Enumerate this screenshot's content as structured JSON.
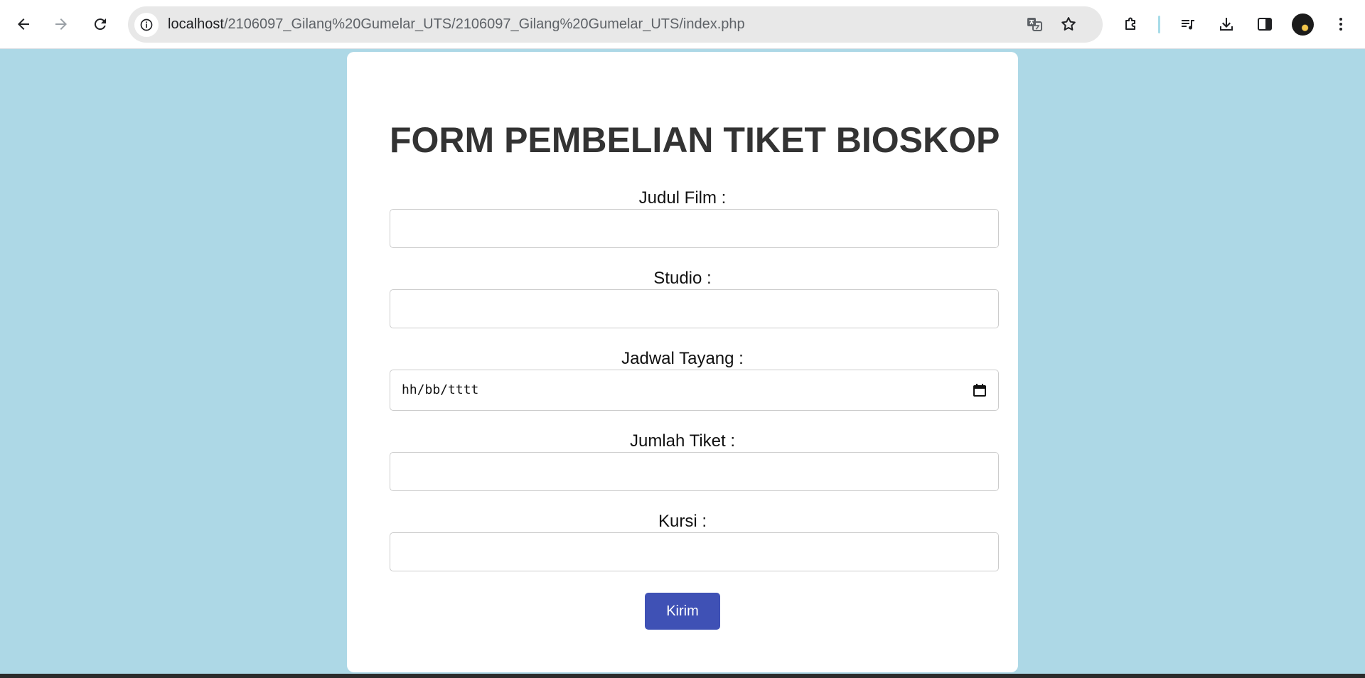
{
  "browser": {
    "url_host": "localhost",
    "url_path": "/2106097_Gilang%20Gumelar_UTS/2106097_Gilang%20Gumelar_UTS/index.php",
    "icons": [
      "back-icon",
      "forward-icon",
      "reload-icon",
      "site-info-icon",
      "translate-icon",
      "bookmark-star-icon",
      "extensions-icon",
      "media-controls-icon",
      "download-icon",
      "side-panel-icon",
      "profile-avatar",
      "more-menu-icon"
    ]
  },
  "form": {
    "title": "FORM PEMBELIAN TIKET BIOSKOP",
    "fields": [
      {
        "label": "Judul Film :",
        "value": ""
      },
      {
        "label": "Studio :",
        "value": ""
      },
      {
        "label": "Jadwal Tayang :",
        "placeholder": "hh/bb/tttt"
      },
      {
        "label": "Jumlah Tiket :",
        "value": ""
      },
      {
        "label": "Kursi :",
        "value": ""
      }
    ],
    "submit_label": "Kirim"
  },
  "colors": {
    "page_background": "#add8e6",
    "card_background": "#ffffff",
    "button_background": "#3f51b5",
    "title_text": "#333333"
  }
}
